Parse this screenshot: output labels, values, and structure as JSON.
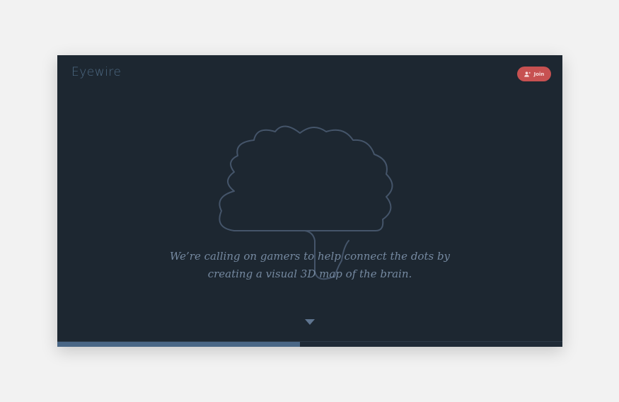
{
  "header": {
    "logo_text": "Eyewire",
    "join_label": "Join",
    "join_icon": "add-user-icon"
  },
  "hero": {
    "tagline_line1": "We’re calling on gamers to help connect the dots by",
    "tagline_line2": "creating a visual 3D map of the brain.",
    "illustration": "brain-outline-icon",
    "scroll_icon": "triangle-down-icon"
  },
  "progress": {
    "fraction": 0.48
  },
  "colors": {
    "background": "#1d2731",
    "page": "#f2f2f2",
    "accent": "#c75151",
    "logo": "#4f6b85",
    "text": "#7589a0",
    "progress_fill": "#4a6786"
  }
}
